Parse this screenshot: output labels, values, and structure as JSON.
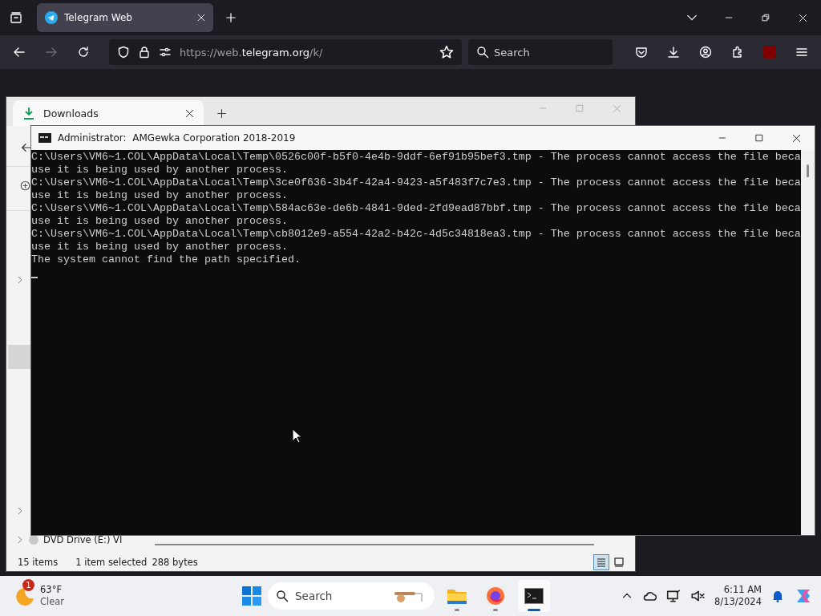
{
  "browser": {
    "tabs": [
      {
        "title": "Telegram Web",
        "selected": true
      }
    ],
    "url": {
      "scheme": "https://web.",
      "domain": "telegram.org",
      "path": "/k/"
    },
    "search": {
      "placeholder": "Search"
    }
  },
  "explorer": {
    "tab": "Downloads",
    "nav_item": "DVD Drive (E:) VI",
    "status": {
      "count": "15 items",
      "selection": "1 item selected",
      "size": "288 bytes"
    },
    "views": [
      {
        "kind": "details",
        "selected": true
      },
      {
        "kind": "tiles",
        "selected": false
      }
    ]
  },
  "console": {
    "title": "Administrator:  AMGewka Corporation 2018-2019",
    "lines": [
      "C:\\Users\\VM6~1.COL\\AppData\\Local\\Temp\\0526c00f-b5f0-4e4b-9ddf-6ef91b95bef3.tmp - The process cannot access the file beca",
      "use it is being used by another process.",
      "C:\\Users\\VM6~1.COL\\AppData\\Local\\Temp\\3ce0f636-3b4f-42a4-9423-a5f483f7c7e3.tmp - The process cannot access the file beca",
      "use it is being used by another process.",
      "C:\\Users\\VM6~1.COL\\AppData\\Local\\Temp\\584ac63e-de6b-4841-9ded-2fd9ead87bbf.tmp - The process cannot access the file beca",
      "use it is being used by another process.",
      "C:\\Users\\VM6~1.COL\\AppData\\Local\\Temp\\cb8012e9-a554-42a2-b42c-4d5c34818ea3.tmp - The process cannot access the file beca",
      "use it is being used by another process.",
      "The system cannot find the path specified."
    ]
  },
  "taskbar": {
    "weather": {
      "badge": "1",
      "temp": "63°F",
      "condition": "Clear"
    },
    "search": {
      "placeholder": "Search"
    },
    "apps": [
      {
        "kind": "files",
        "selected": false
      },
      {
        "kind": "firefox",
        "selected": false
      },
      {
        "kind": "terminal",
        "selected": true
      }
    ],
    "time": "6:11 AM",
    "date": "8/13/2024"
  }
}
